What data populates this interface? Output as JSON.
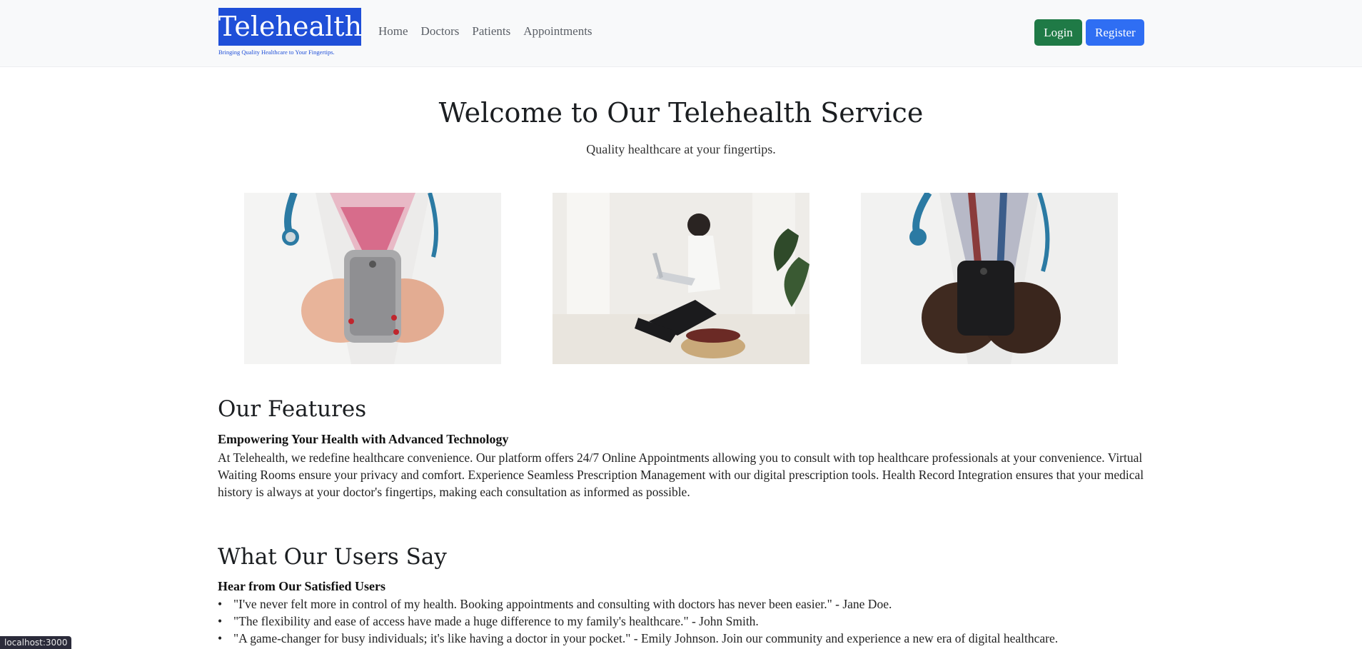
{
  "header": {
    "brand": "Telehealth",
    "tagline": "Bringing Quality Healthcare to Your Fingertips.",
    "nav": [
      "Home",
      "Doctors",
      "Patients",
      "Appointments"
    ],
    "login": "Login",
    "register": "Register"
  },
  "hero": {
    "title": "Welcome to Our Telehealth Service",
    "subtitle": "Quality healthcare at your fingertips."
  },
  "features": {
    "title": "Our Features",
    "subtitle": "Empowering Your Health with Advanced Technology",
    "body": "At Telehealth, we redefine healthcare convenience. Our platform offers 24/7 Online Appointments allowing you to consult with top healthcare professionals at your convenience. Virtual Waiting Rooms ensure your privacy and comfort. Experience Seamless Prescription Management with our digital prescription tools. Health Record Integration ensures that your medical history is always at your doctor's fingertips, making each consultation as informed as possible."
  },
  "testimonials": {
    "title": "What Our Users Say",
    "subtitle": "Hear from Our Satisfied Users",
    "items": [
      "\"I've never felt more in control of my health. Booking appointments and consulting with doctors has never been easier.\" - Jane Doe.",
      "\"The flexibility and ease of access have made a huge difference to my family's healthcare.\" - John Smith.",
      "\"A game-changer for busy individuals; it's like having a doctor in your pocket.\" - Emily Johnson. Join our community and experience a new era of digital healthcare."
    ]
  },
  "status_url": "localhost:3000",
  "colors": {
    "brand": "#1f4fd8",
    "login": "#1f7a46",
    "register": "#2f6ef3",
    "navbar_bg": "#f8f9fa"
  }
}
